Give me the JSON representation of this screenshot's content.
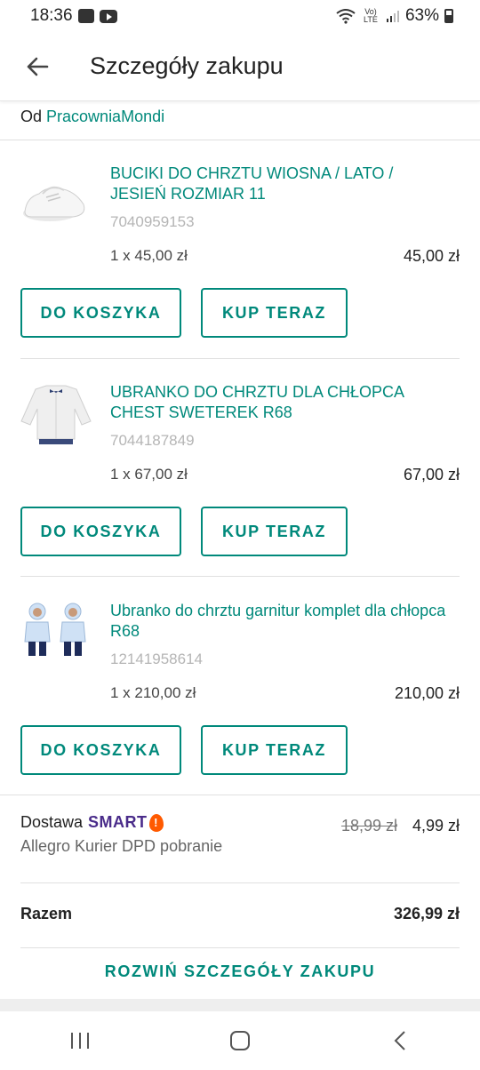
{
  "status_bar": {
    "time": "18:36",
    "network": "Vo) LTE",
    "battery": "63%"
  },
  "header": {
    "title": "Szczegóły zakupu",
    "back_icon": "arrow-left-icon"
  },
  "seller": {
    "prefix": "Od",
    "name": "PracowniaMondi"
  },
  "items": [
    {
      "title": "BUCIKI DO CHRZTU WIOSNA / LATO / JESIEŃ ROZMIAR 11",
      "id": "7040959153",
      "qty": "1 x 45,00 zł",
      "price": "45,00 zł",
      "cart_label": "DO KOSZYKA",
      "buy_label": "KUP TERAZ"
    },
    {
      "title": "UBRANKO DO CHRZTU DLA CHŁOPCA CHEST SWETEREK R68",
      "id": "7044187849",
      "qty": "1 x 67,00 zł",
      "price": "67,00 zł",
      "cart_label": "DO KOSZYKA",
      "buy_label": "KUP TERAZ"
    },
    {
      "title": "Ubranko do chrztu garnitur komplet dla chłopca R68",
      "id": "12141958614",
      "qty": "1 x 210,00 zł",
      "price": "210,00 zł",
      "cart_label": "DO KOSZYKA",
      "buy_label": "KUP TERAZ"
    }
  ],
  "delivery": {
    "label": "Dostawa",
    "badge": "SMART",
    "badge_mark": "!",
    "carrier": "Allegro Kurier DPD pobranie",
    "old_price": "18,99 zł",
    "new_price": "4,99 zł"
  },
  "total": {
    "label": "Razem",
    "value": "326,99 zł"
  },
  "expand_label": "ROZWIŃ SZCZEGÓŁY ZAKUPU",
  "colors": {
    "accent": "#00897b",
    "smart": "#4a2c8a",
    "smart_mark": "#ff5a00"
  }
}
